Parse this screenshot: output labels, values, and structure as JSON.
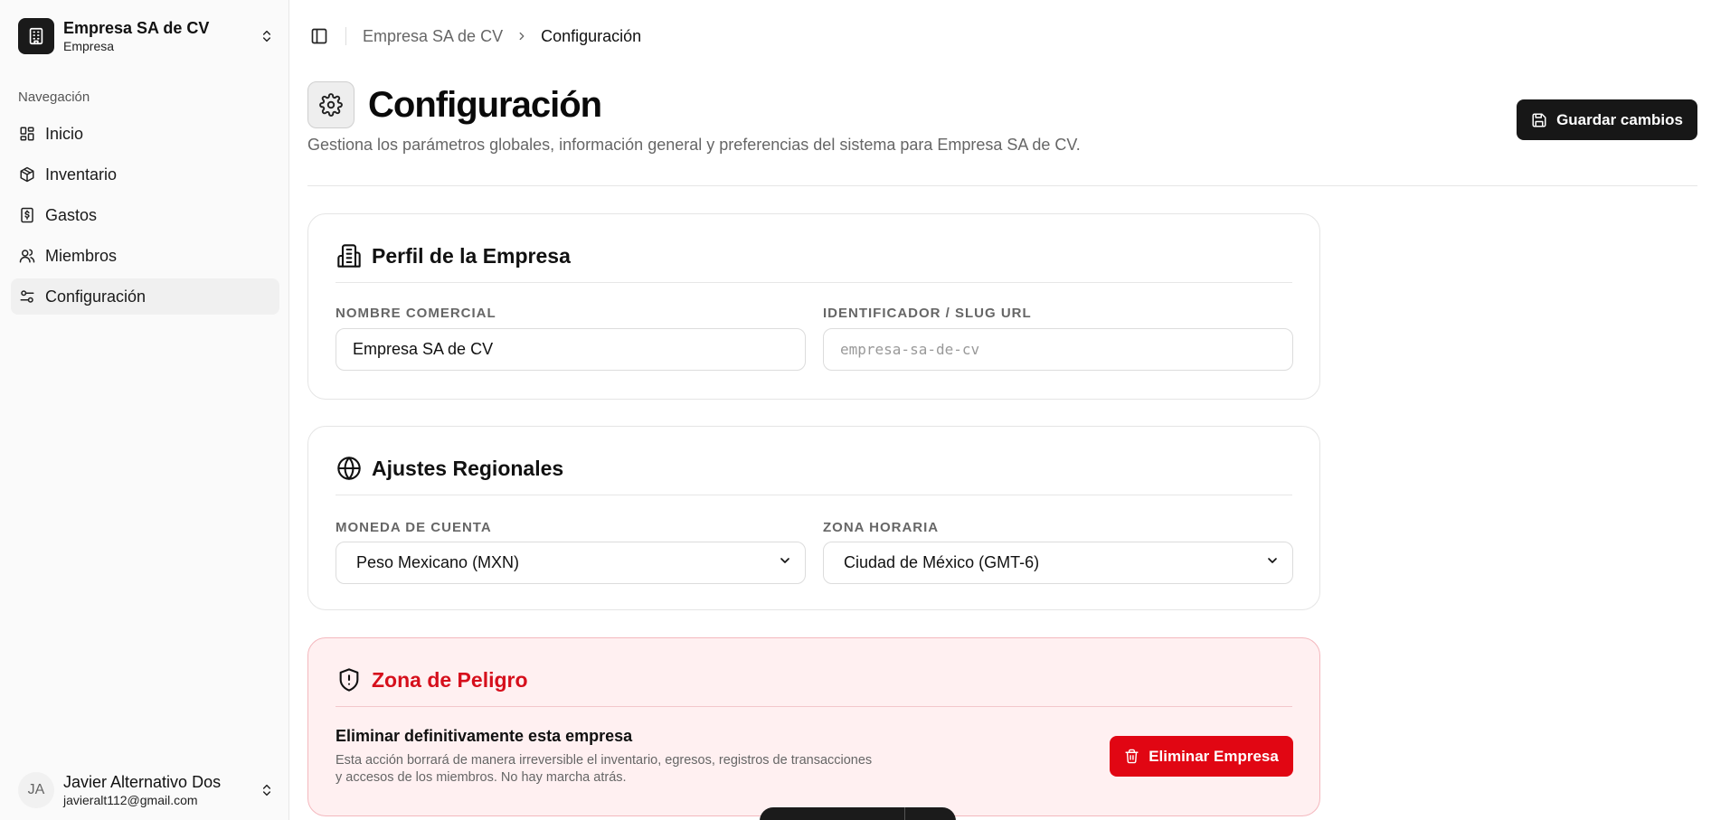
{
  "sidebar": {
    "org": {
      "name": "Empresa SA de CV",
      "type": "Empresa"
    },
    "nav_heading": "Navegación",
    "items": [
      {
        "label": "Inicio",
        "icon": "dashboard-icon"
      },
      {
        "label": "Inventario",
        "icon": "package-icon"
      },
      {
        "label": "Gastos",
        "icon": "receipt-icon"
      },
      {
        "label": "Miembros",
        "icon": "users-icon"
      },
      {
        "label": "Configuración",
        "icon": "settings-sliders-icon",
        "active": true
      }
    ],
    "user": {
      "initials": "JA",
      "name": "Javier Alternativo Dos",
      "email": "javieralt112@gmail.com"
    }
  },
  "breadcrumb": {
    "parent": "Empresa SA de CV",
    "current": "Configuración"
  },
  "header": {
    "title": "Configuración",
    "description": "Gestiona los parámetros globales, información general y preferencias del sistema para Empresa SA de CV.",
    "save_label": "Guardar cambios"
  },
  "profile": {
    "title": "Perfil de la Empresa",
    "name_label": "NOMBRE COMERCIAL",
    "name_value": "Empresa SA de CV",
    "slug_label": "IDENTIFICADOR / SLUG URL",
    "slug_placeholder": "empresa-sa-de-cv"
  },
  "regional": {
    "title": "Ajustes Regionales",
    "currency_label": "MONEDA DE CUENTA",
    "currency_value": "Peso Mexicano (MXN)",
    "timezone_label": "ZONA HORARIA",
    "timezone_value": "Ciudad de México (GMT-6)"
  },
  "danger": {
    "title": "Zona de Peligro",
    "action_title": "Eliminar definitivamente esta empresa",
    "action_desc": "Esta acción borrará de manera irreversible el inventario, egresos, registros de transacciones y accesos de los miembros. No hay marcha atrás.",
    "button_label": "Eliminar Empresa"
  },
  "colors": {
    "primary": "#171717",
    "danger": "#e10613",
    "danger_bg": "#fff0f1"
  }
}
